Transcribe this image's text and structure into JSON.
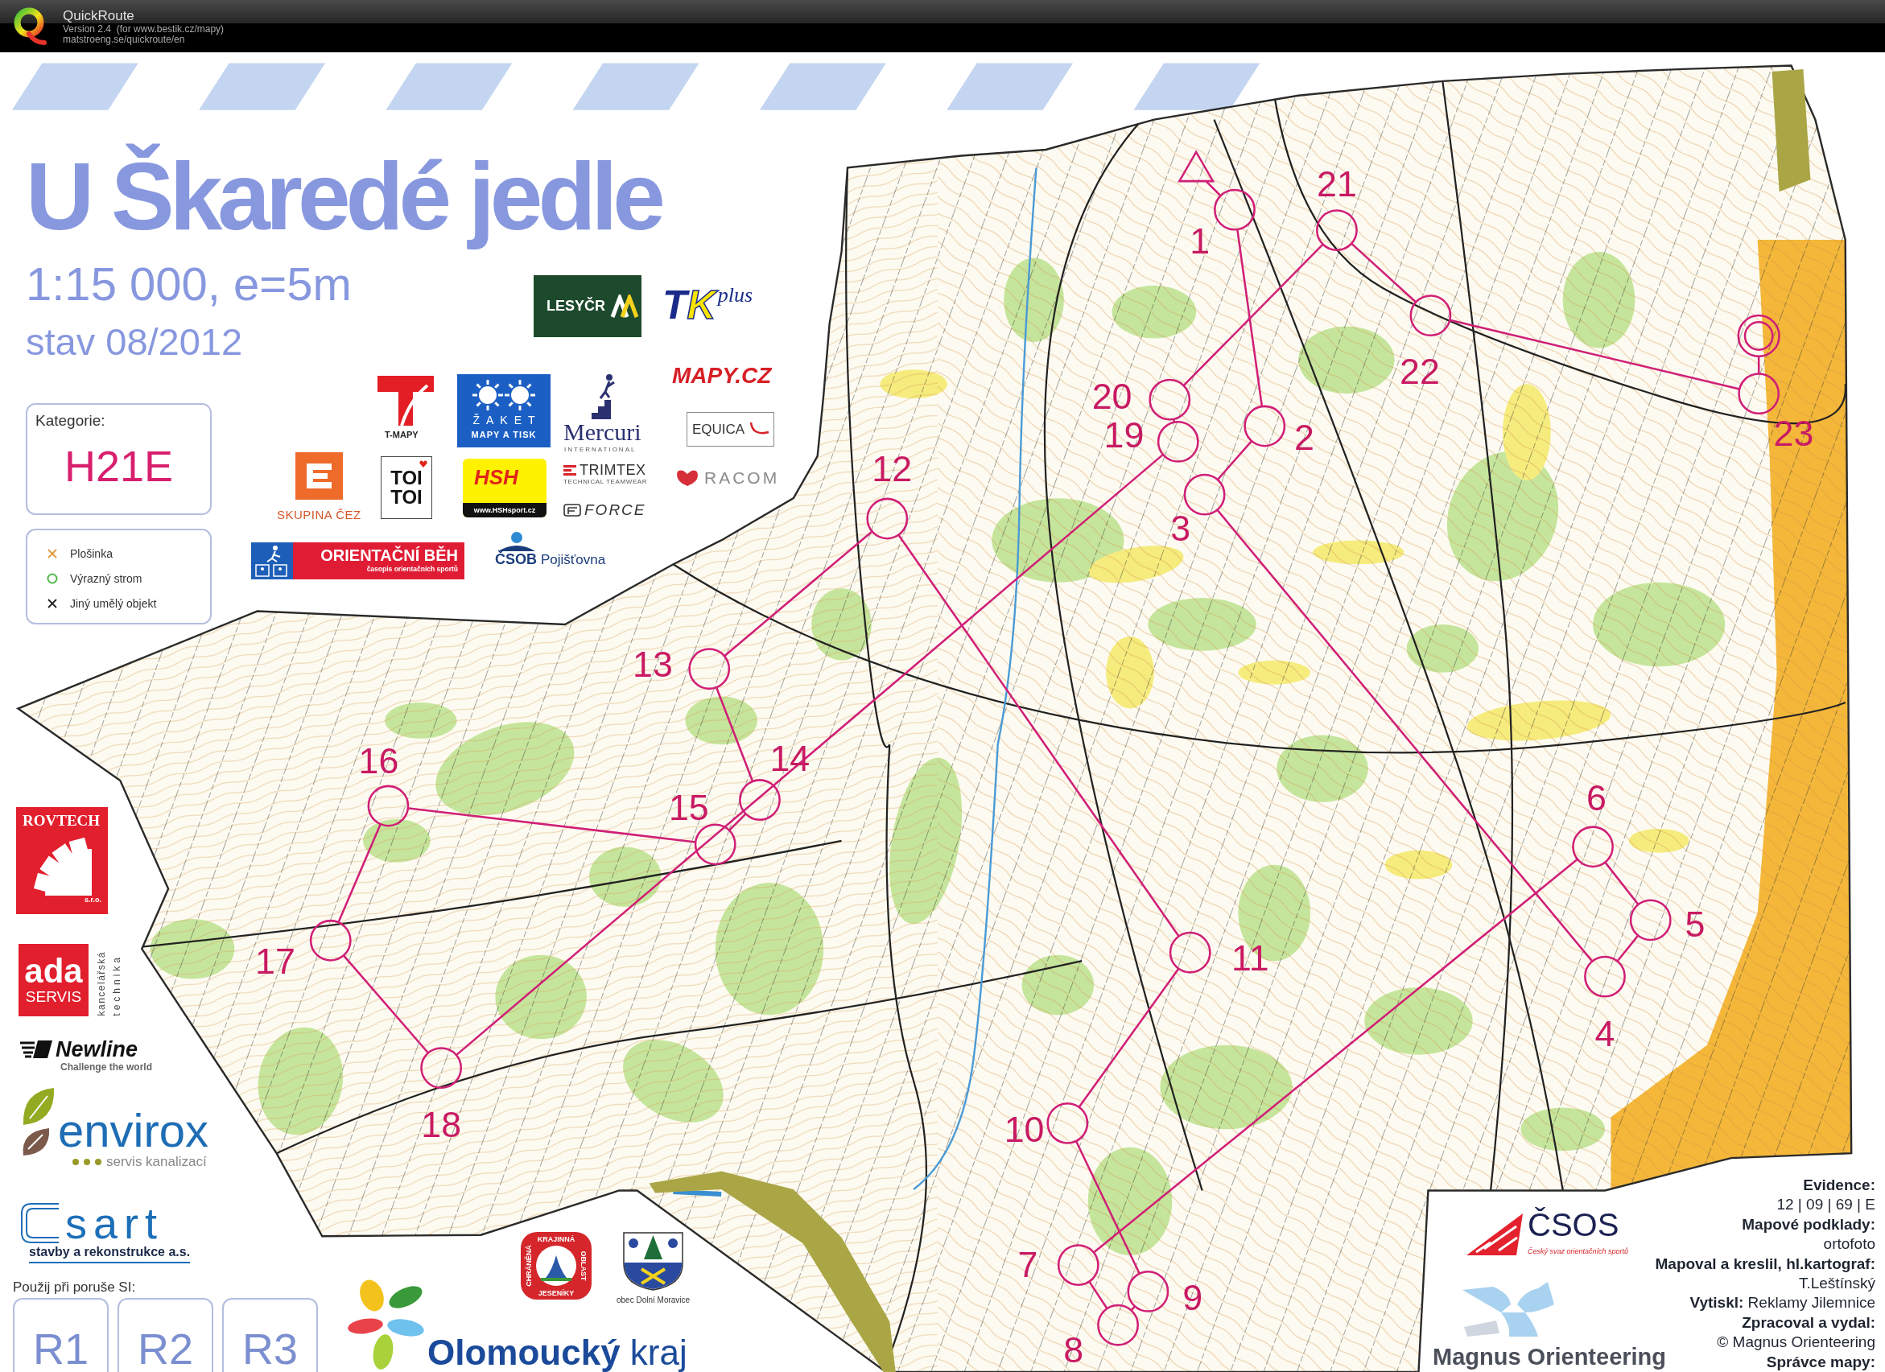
{
  "app_header": {
    "title": "QuickRoute",
    "version": "Version 2.4  (for www.bestik.cz/mapy)",
    "website": "matstroeng.se/quickroute/en"
  },
  "map_sheet": {
    "title": "U Škaredé jedle",
    "scale": "1:15 000, e=5m",
    "revision": "stav 08/2012",
    "category": {
      "label": "Kategorie:",
      "value": "H21E"
    },
    "legend": [
      {
        "kind": "cross",
        "color": "#e39a3b",
        "label": "Plošinka"
      },
      {
        "kind": "circle",
        "color": "#4db848",
        "label": "Výrazný strom"
      },
      {
        "kind": "cross",
        "color": "#222222",
        "label": "Jiný umělý objekt"
      }
    ],
    "logos": {
      "lesy_cr": {
        "name": "LESYČR"
      },
      "tk_plus": {
        "letters": [
          "T",
          "K"
        ],
        "script": "plus"
      },
      "t_mapy": {
        "name": "T-MAPY"
      },
      "zaket": {
        "name": "ŽAKET",
        "tagline": "MAPY A TISK"
      },
      "mercuri": {
        "name": "Mercuri",
        "tagline": "INTERNATIONAL"
      },
      "mapy_cz": {
        "name": "MAPY.CZ"
      },
      "equica": {
        "name": "EQUICA"
      },
      "cez": {
        "name": "SKUPINA ČEZ"
      },
      "toi_toi": {
        "lines": [
          "TOI",
          "TOI"
        ]
      },
      "hsh": {
        "name": "HSH",
        "url": "www.HSHsport.cz"
      },
      "trimtex": {
        "name": "TRIMTEX",
        "tagline": "TECHNICAL TEAMWEAR"
      },
      "force": {
        "name": "FORCE"
      },
      "racom": {
        "name": "RACOM"
      },
      "orientacni_beh": {
        "name": "ORIENTAČNÍ BĚH",
        "tagline": "časopis orientačních sportů"
      },
      "csob": {
        "name": "ČSOB",
        "product": "Pojišťovna"
      },
      "rovtech": {
        "name": "ROVTECH",
        "suffix": "s.r.o."
      },
      "ada": {
        "name": "ada",
        "word": "SERVIS",
        "side_lines": [
          "kancelářská",
          "technika"
        ]
      },
      "newline": {
        "name": "Newline",
        "tagline": "Challenge the world"
      },
      "envirox": {
        "name": "envirox",
        "tagline": "servis kanalizací"
      },
      "sart": {
        "name": "sart",
        "tagline": "stavby a rekonstrukce a.s."
      },
      "chko": {
        "ring_texts": [
          "CHRÁNĚNÁ",
          "KRAJINNÁ",
          "OBLAST",
          "JESENÍKY"
        ]
      },
      "dolni_moravice": {
        "caption": "obec Dolní Moravice"
      },
      "olomoucky_kraj": {
        "name": "**Olomoucký** kraj"
      },
      "csos": {
        "name": "ČSOS",
        "tagline": "Český svaz orientačních sportů"
      },
      "magnus": {
        "name": "Magnus Orienteering"
      }
    },
    "si_backup": {
      "label": "Použij při poruše SI:",
      "boxes": [
        "R1",
        "R2",
        "R3"
      ]
    },
    "course": {
      "controls": [
        {
          "number": "1"
        },
        {
          "number": "2"
        },
        {
          "number": "3"
        },
        {
          "number": "4"
        },
        {
          "number": "5"
        },
        {
          "number": "6"
        },
        {
          "number": "7"
        },
        {
          "number": "8"
        },
        {
          "number": "9"
        },
        {
          "number": "10"
        },
        {
          "number": "11"
        },
        {
          "number": "12"
        },
        {
          "number": "13"
        },
        {
          "number": "14"
        },
        {
          "number": "15"
        },
        {
          "number": "16"
        },
        {
          "number": "17"
        },
        {
          "number": "18"
        },
        {
          "number": "19"
        },
        {
          "number": "20"
        },
        {
          "number": "21"
        },
        {
          "number": "22"
        },
        {
          "number": "23"
        }
      ]
    },
    "credits": [
      {
        "kind": "heading",
        "text": "Evidence:"
      },
      {
        "kind": "value",
        "text": "12 | 09 | 69 | E"
      },
      {
        "kind": "heading",
        "text": "Mapové podklady:"
      },
      {
        "kind": "value",
        "text": "ortofoto"
      },
      {
        "kind": "heading",
        "text": "Mapoval a kreslil, hl.kartograf:"
      },
      {
        "kind": "value",
        "text": "T.Leštínský"
      },
      {
        "kind": "value",
        "text": "**Vytiskl:** Reklamy Jilemnice"
      },
      {
        "kind": "heading",
        "text": "Zpracoval a vydal:"
      },
      {
        "kind": "value",
        "text": "© Magnus Orienteering"
      },
      {
        "kind": "heading",
        "text": "Správce mapy:"
      }
    ]
  }
}
